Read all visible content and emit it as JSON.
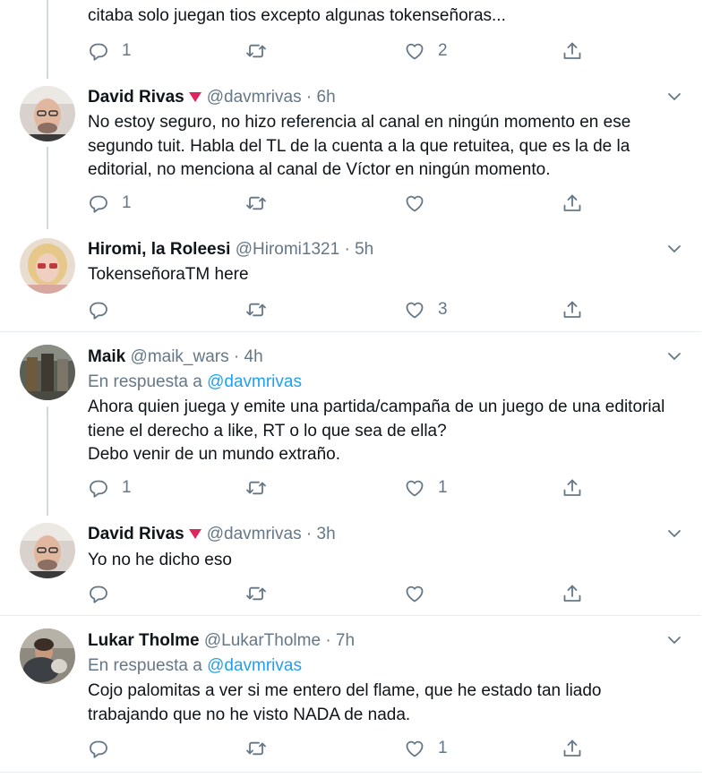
{
  "top_tweet": {
    "text_lines": [
      "citaba solo juegan tios excepto algunas tokenseñoras..."
    ],
    "reply_count": "1",
    "retweet_count": "",
    "like_count": "2"
  },
  "tweets": [
    {
      "name": "David Rivas",
      "handle": "@davmrivas",
      "time": "6h",
      "dot": "·",
      "reply_prefix": "",
      "reply_to": "",
      "text_lines": [
        "No estoy seguro, no hizo referencia al canal en ningún momento en ese",
        "segundo tuit. Habla del TL de la cuenta a la que retuitea, que es la de la",
        "editorial, no menciona al canal de Víctor en ningún momento."
      ],
      "reply_count": "1",
      "retweet_count": "",
      "like_count": ""
    },
    {
      "name": "Hiromi, la Roleesi",
      "handle": "@Hiromi1321",
      "time": "5h",
      "dot": "·",
      "reply_prefix": "",
      "reply_to": "",
      "text_lines": [
        "TokenseñoraTM here"
      ],
      "reply_count": "",
      "retweet_count": "",
      "like_count": "3"
    },
    {
      "name": "Maik",
      "handle": "@maik_wars",
      "time": "4h",
      "dot": "·",
      "reply_prefix": "En respuesta a",
      "reply_to": "@davmrivas",
      "text_lines": [
        "Ahora quien juega y emite una partida/campaña de un juego de una editorial",
        "tiene el derecho a like, RT o lo que sea de ella?",
        "Debo venir de un mundo extraño."
      ],
      "reply_count": "1",
      "retweet_count": "",
      "like_count": "1"
    },
    {
      "name": "David Rivas",
      "handle": "@davmrivas",
      "time": "3h",
      "dot": "·",
      "reply_prefix": "",
      "reply_to": "",
      "text_lines": [
        "Yo no he dicho eso"
      ],
      "reply_count": "",
      "retweet_count": "",
      "like_count": ""
    },
    {
      "name": "Lukar Tholme",
      "handle": "@LukarTholme",
      "time": "7h",
      "dot": "·",
      "reply_prefix": "En respuesta a",
      "reply_to": "@davmrivas",
      "text_lines": [
        "Cojo palomitas a ver si me entero del flame, que he estado tan liado",
        "trabajando que no he visto NADA de nada."
      ],
      "reply_count": "",
      "retweet_count": "",
      "like_count": "1"
    }
  ],
  "icons": {
    "reply": "reply-icon",
    "retweet": "retweet-icon",
    "like": "heart-icon",
    "share": "share-icon",
    "more": "chevron-down-icon",
    "verified_badge": "heart-triangle-badge"
  },
  "colors": {
    "text": "#0f1419",
    "secondary": "#657786",
    "link": "#1da1f2",
    "divider": "#e6ecf0",
    "badge": "#e0245e"
  }
}
